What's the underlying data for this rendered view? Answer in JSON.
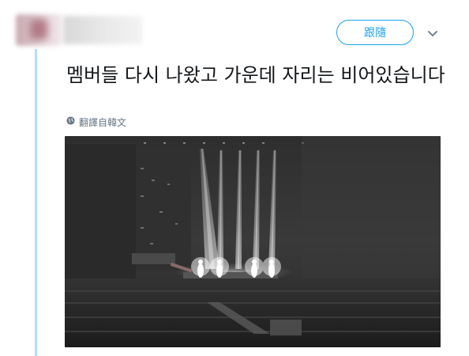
{
  "header": {
    "follow_label": "跟隨"
  },
  "tweet": {
    "text": "멤버들 다시 나왔고 가운데 자리는 비어있습니다",
    "translate_label": "翻譯自韓文"
  },
  "icons": {
    "chevron": "chevron-down-icon",
    "globe": "globe-icon"
  },
  "colors": {
    "accent": "#1da1f2",
    "thread_line": "#b7dcf5",
    "text": "#14171a",
    "muted": "#657786"
  }
}
